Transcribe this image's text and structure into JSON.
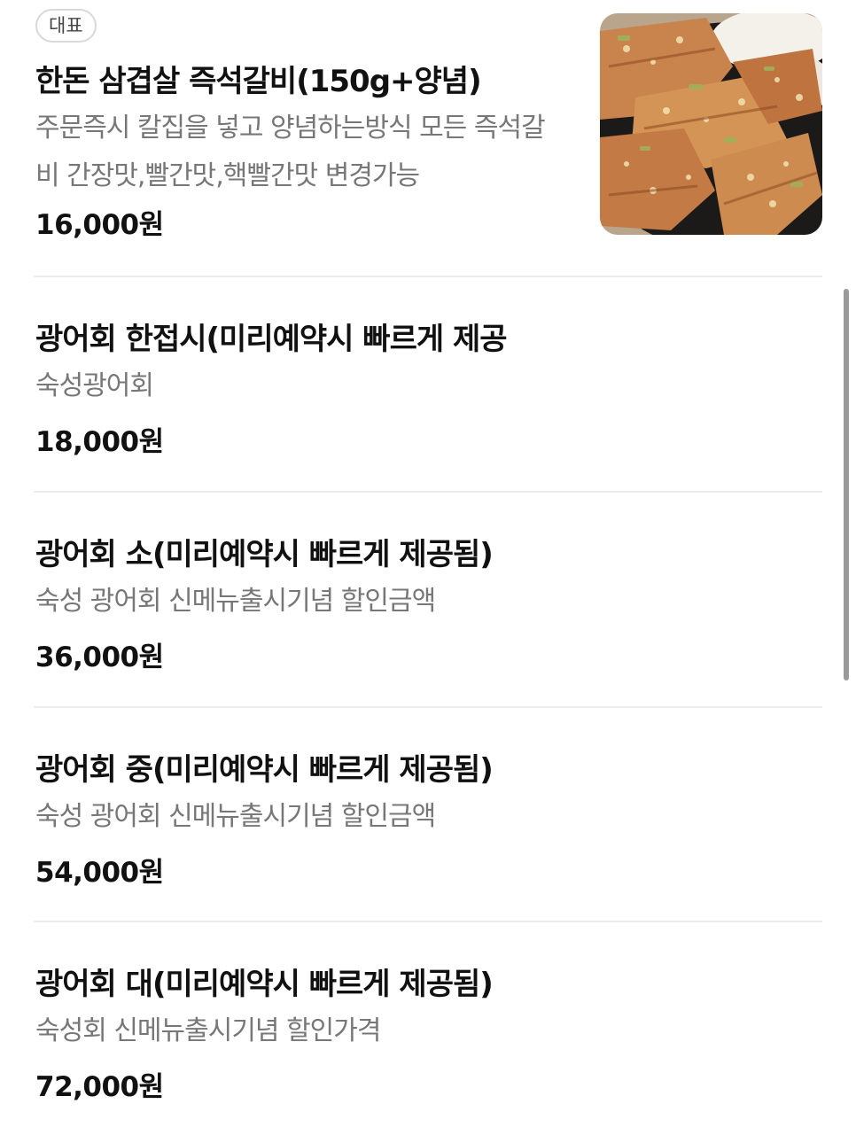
{
  "menu": {
    "items": [
      {
        "badge": "대표",
        "name": "한돈 삼겹살 즉석갈비(150g+양념)",
        "description": "주문즉시 칼집을 넣고 양념하는방식 모든 즉석갈비 간장맛,빨간맛,핵빨간맛 변경가능",
        "price": "16,000원",
        "image": "grilled-pork-belly-galbi-photo"
      },
      {
        "name": "광어회 한접시(미리예약시 빠르게 제공",
        "description": "숙성광어회",
        "price": "18,000원"
      },
      {
        "name": "광어회 소(미리예약시 빠르게 제공됨)",
        "description": "숙성 광어회 신메뉴출시기념 할인금액",
        "price": "36,000원"
      },
      {
        "name": "광어회 중(미리예약시 빠르게 제공됨)",
        "description": "숙성 광어회 신메뉴출시기념 할인금액",
        "price": "54,000원"
      },
      {
        "name": "광어회 대(미리예약시 빠르게 제공됨)",
        "description": "숙성회 신메뉴출시기념 할인가격",
        "price": "72,000원"
      }
    ]
  },
  "colors": {
    "text_primary": "#111111",
    "text_secondary": "#777777",
    "divider": "#ededed",
    "badge_border": "#d9d9d9"
  }
}
